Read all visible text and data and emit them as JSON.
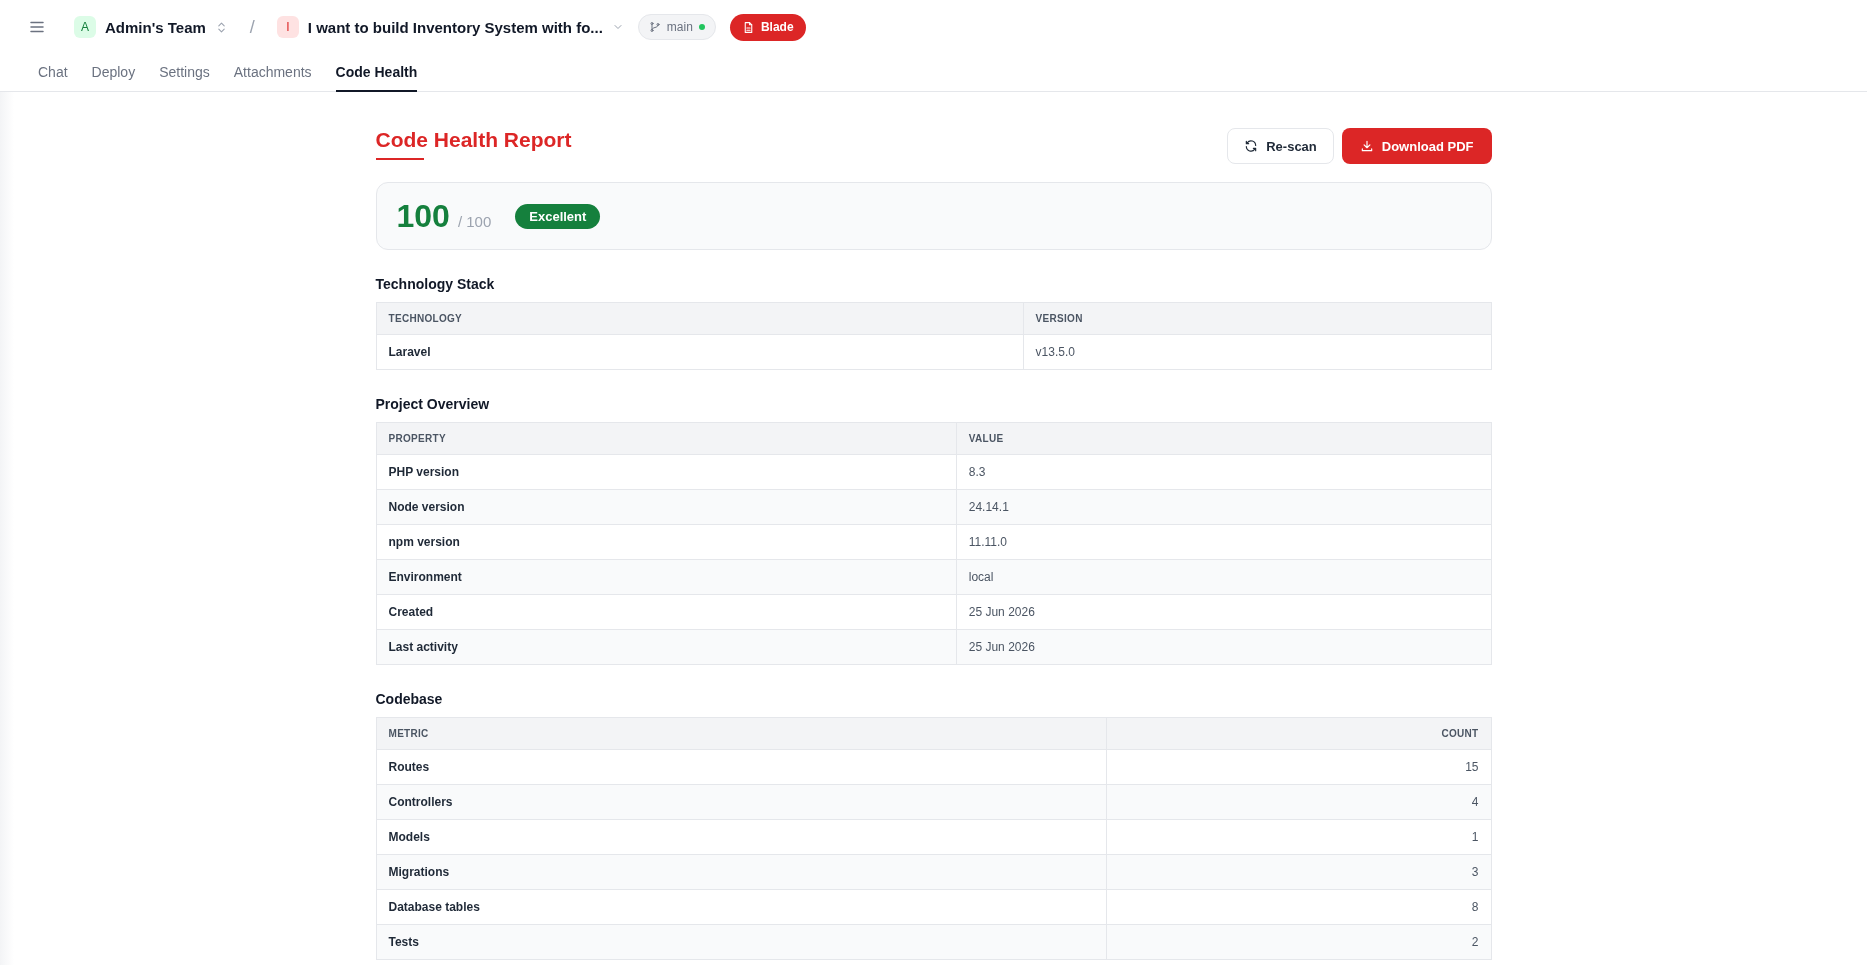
{
  "header": {
    "team": {
      "initial": "A",
      "name": "Admin's Team"
    },
    "separator": "/",
    "project": {
      "initial": "I",
      "name": "I want to build Inventory System with fo..."
    },
    "branch": {
      "name": "main",
      "online": true
    },
    "stack_button": "Blade"
  },
  "tabs": [
    {
      "label": "Chat",
      "selected": false
    },
    {
      "label": "Deploy",
      "selected": false
    },
    {
      "label": "Settings",
      "selected": false
    },
    {
      "label": "Attachments",
      "selected": false
    },
    {
      "label": "Code Health",
      "selected": true
    }
  ],
  "report": {
    "title": "Code Health Report",
    "rescan_button": "Re-scan",
    "download_button": "Download PDF",
    "score": "100",
    "score_max": "/ 100",
    "grade": "Excellent"
  },
  "sections": [
    {
      "title": "Technology Stack",
      "columns": [
        "TECHNOLOGY",
        "VERSION"
      ],
      "rows": [
        [
          "Laravel",
          "v13.5.0"
        ]
      ]
    },
    {
      "title": "Project Overview",
      "columns": [
        "PROPERTY",
        "VALUE"
      ],
      "rows": [
        [
          "PHP version",
          "8.3"
        ],
        [
          "Node version",
          "24.14.1"
        ],
        [
          "npm version",
          "11.11.0"
        ],
        [
          "Environment",
          "local"
        ],
        [
          "Created",
          "25 Jun 2026"
        ],
        [
          "Last activity",
          "25 Jun 2026"
        ]
      ]
    },
    {
      "title": "Codebase",
      "columns": [
        "METRIC",
        "COUNT"
      ],
      "rows": [
        [
          "Routes",
          "15"
        ],
        [
          "Controllers",
          "4"
        ],
        [
          "Models",
          "1"
        ],
        [
          "Migrations",
          "3"
        ],
        [
          "Database tables",
          "8"
        ],
        [
          "Tests",
          "2"
        ]
      ]
    }
  ]
}
